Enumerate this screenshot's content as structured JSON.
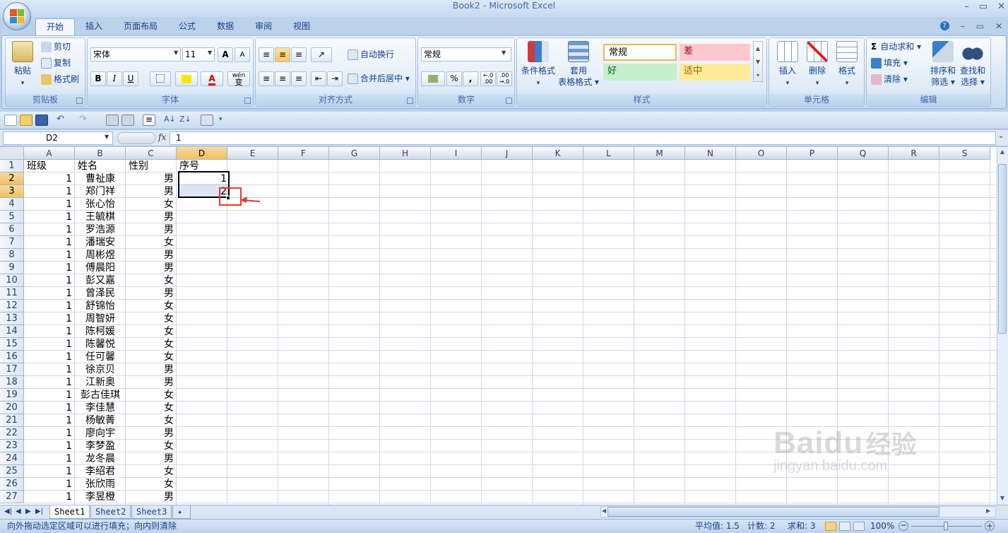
{
  "window": {
    "title": "Book2 - Microsoft Excel",
    "controls": [
      "–",
      "▭",
      "✕"
    ]
  },
  "ribbon_tabs": [
    "开始",
    "插入",
    "页面布局",
    "公式",
    "数据",
    "审阅",
    "视图"
  ],
  "clipboard": {
    "paste": "粘贴",
    "cut": "剪切",
    "copy": "复制",
    "format_painter": "格式刷",
    "label": "剪贴板"
  },
  "font": {
    "name": "宋体",
    "size": "11",
    "grow": "A",
    "shrink": "A",
    "bold": "B",
    "italic": "I",
    "underline": "U",
    "wen": "wén",
    "wen2": "变",
    "label": "字体"
  },
  "alignment": {
    "wrap": "自动换行",
    "merge": "合并后居中",
    "label": "对齐方式"
  },
  "number": {
    "format": "常规",
    "percent": "%",
    "comma": ",",
    "inc": "+.0\n.00",
    "dec": ".00\n+.0",
    "label": "数字"
  },
  "styles": {
    "conditional": "条件格式",
    "table_format_1": "套用",
    "table_format_2": "表格格式",
    "normal": "常规",
    "bad": "差",
    "good": "好",
    "neutral": "适中",
    "label": "样式"
  },
  "cells_group": {
    "insert": "插入",
    "delete": "删除",
    "format": "格式",
    "label": "单元格"
  },
  "editing": {
    "autosum": "自动求和",
    "fill": "填充",
    "clear": "清除",
    "sort_1": "排序和",
    "sort_2": "筛选",
    "find_1": "查找和",
    "find_2": "选择",
    "label": "编辑"
  },
  "formula_bar": {
    "name_box": "D2",
    "fx": "fx",
    "value": "1"
  },
  "columns": [
    "A",
    "B",
    "C",
    "D",
    "E",
    "F",
    "G",
    "H",
    "I",
    "J",
    "K",
    "L",
    "M",
    "N",
    "O",
    "P",
    "Q",
    "R",
    "S"
  ],
  "headers": {
    "a": "班级",
    "b": "姓名",
    "c": "性别",
    "d": "序号"
  },
  "rows": [
    {
      "n": "1"
    },
    {
      "n": "2",
      "a": "1",
      "b": "曹祉康",
      "c": "男",
      "d": "1"
    },
    {
      "n": "3",
      "a": "1",
      "b": "郑门祥",
      "c": "男",
      "d": "2"
    },
    {
      "n": "4",
      "a": "1",
      "b": "张心怡",
      "c": "女"
    },
    {
      "n": "5",
      "a": "1",
      "b": "王毓棋",
      "c": "男"
    },
    {
      "n": "6",
      "a": "1",
      "b": "罗浩源",
      "c": "男"
    },
    {
      "n": "7",
      "a": "1",
      "b": "潘瑞安",
      "c": "女"
    },
    {
      "n": "8",
      "a": "1",
      "b": "周彬煜",
      "c": "男"
    },
    {
      "n": "9",
      "a": "1",
      "b": "傅晨阳",
      "c": "男"
    },
    {
      "n": "10",
      "a": "1",
      "b": "彭又嘉",
      "c": "女"
    },
    {
      "n": "11",
      "a": "1",
      "b": "曾泽民",
      "c": "男"
    },
    {
      "n": "12",
      "a": "1",
      "b": "舒锦怡",
      "c": "女"
    },
    {
      "n": "13",
      "a": "1",
      "b": "周智妍",
      "c": "女"
    },
    {
      "n": "14",
      "a": "1",
      "b": "陈柯媛",
      "c": "女"
    },
    {
      "n": "15",
      "a": "1",
      "b": "陈馨悦",
      "c": "女"
    },
    {
      "n": "16",
      "a": "1",
      "b": "任可馨",
      "c": "女"
    },
    {
      "n": "17",
      "a": "1",
      "b": "徐京贝",
      "c": "男"
    },
    {
      "n": "18",
      "a": "1",
      "b": "江新奥",
      "c": "男"
    },
    {
      "n": "19",
      "a": "1",
      "b": "彭古佳琪",
      "c": "女"
    },
    {
      "n": "20",
      "a": "1",
      "b": "李佳慧",
      "c": "女"
    },
    {
      "n": "21",
      "a": "1",
      "b": "杨敏菁",
      "c": "女"
    },
    {
      "n": "22",
      "a": "1",
      "b": "廖向宇",
      "c": "男"
    },
    {
      "n": "23",
      "a": "1",
      "b": "李梦盈",
      "c": "女"
    },
    {
      "n": "24",
      "a": "1",
      "b": "龙冬晨",
      "c": "男"
    },
    {
      "n": "25",
      "a": "1",
      "b": "李绍君",
      "c": "女"
    },
    {
      "n": "26",
      "a": "1",
      "b": "张欣雨",
      "c": "女"
    },
    {
      "n": "27",
      "a": "1",
      "b": "李昱橙",
      "c": "男"
    }
  ],
  "sheets": [
    "Sheet1",
    "Sheet2",
    "Sheet3"
  ],
  "status": {
    "message": "向外拖动选定区域可以进行填充；向内则清除",
    "average": "平均值: 1.5",
    "count": "计数: 2",
    "sum": "求和: 3",
    "zoom": "100%"
  },
  "watermark": {
    "brand": "Baidu",
    "cn": "经验",
    "url": "jingyan.baidu.com"
  },
  "colors": {
    "accent": "#15428b",
    "selection_header": "#f1c15f",
    "highlight_red": "#e8372c"
  }
}
